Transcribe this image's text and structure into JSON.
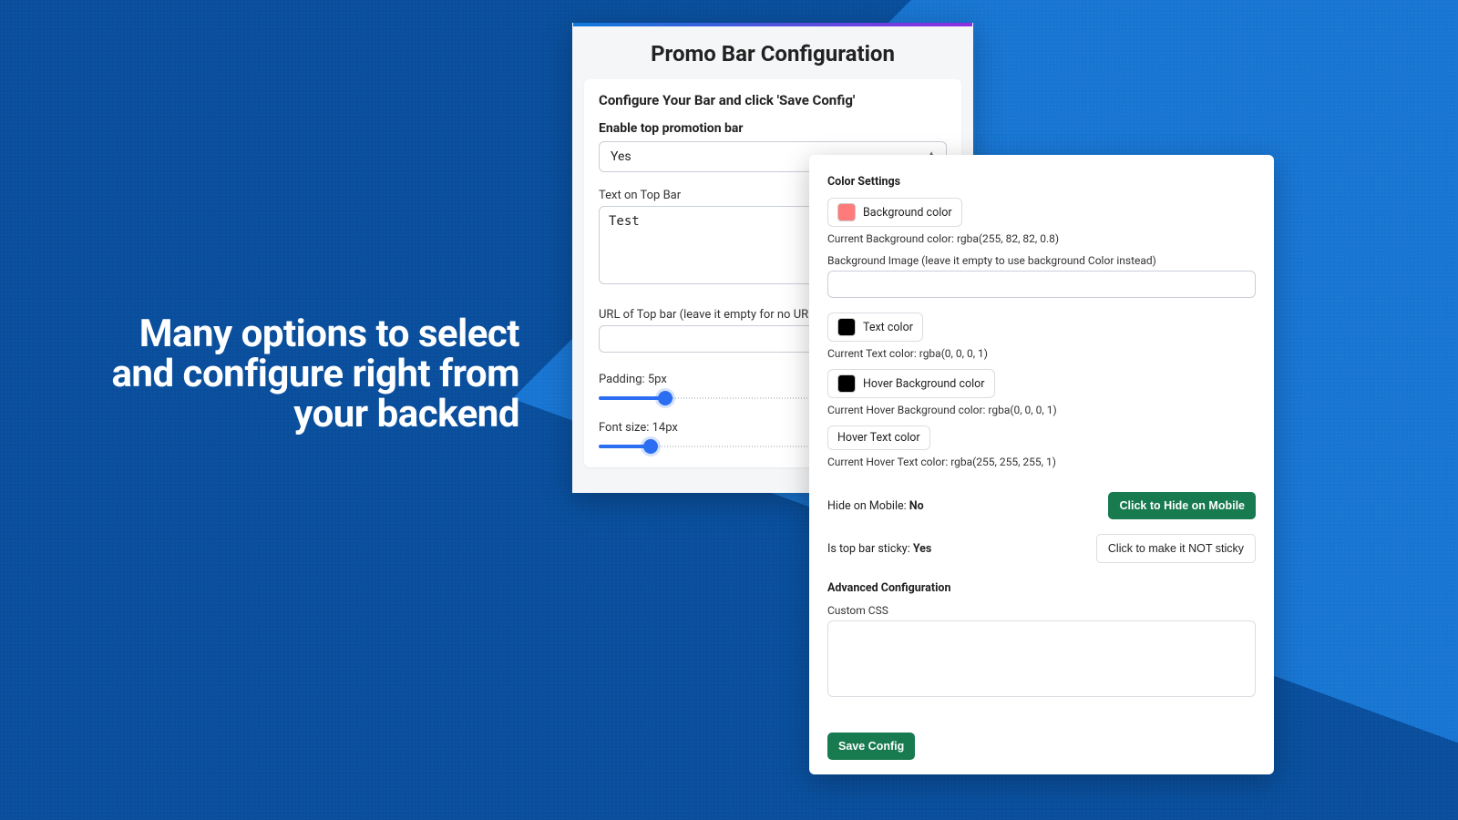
{
  "tagline": "Many options to select and configure right from your backend",
  "left": {
    "title": "Promo Bar Configuration",
    "subtitle": "Configure Your Bar and click 'Save Config'",
    "enable_label": "Enable top promotion bar",
    "enable_value": "Yes",
    "text_label": "Text on Top Bar",
    "text_value": "Test",
    "url_label": "URL of Top bar (leave it empty for no URL)",
    "url_value": "",
    "padding_label": "Padding: 5px",
    "padding_fill_pct": 19,
    "fontsize_label": "Font size: 14px",
    "fontsize_fill_pct": 15
  },
  "right": {
    "section_title": "Color Settings",
    "bg_label": "Background color",
    "bg_swatch": "#ff7a7a",
    "bg_readout": "Current Background color: rgba(255, 82, 82, 0.8)",
    "bg_image_label": "Background Image (leave it empty to use background Color instead)",
    "bg_image_value": "",
    "text_label": "Text color",
    "text_swatch": "#000000",
    "text_readout": "Current Text color: rgba(0, 0, 0, 1)",
    "hover_bg_label": "Hover Background color",
    "hover_bg_swatch": "#000000",
    "hover_bg_readout": "Current Hover Background color: rgba(0, 0, 0, 1)",
    "hover_text_label": "Hover Text color",
    "hover_text_readout": "Current Hover Text color: rgba(255, 255, 255, 1)",
    "hide_mobile_label": "Hide on Mobile:",
    "hide_mobile_value": "No",
    "hide_mobile_btn": "Click to Hide on Mobile",
    "sticky_label": "Is top bar sticky:",
    "sticky_value": "Yes",
    "sticky_btn": "Click to make it NOT sticky",
    "advanced_title": "Advanced Configuration",
    "custom_css_label": "Custom CSS",
    "custom_css_value": "",
    "save_label": "Save Config"
  }
}
